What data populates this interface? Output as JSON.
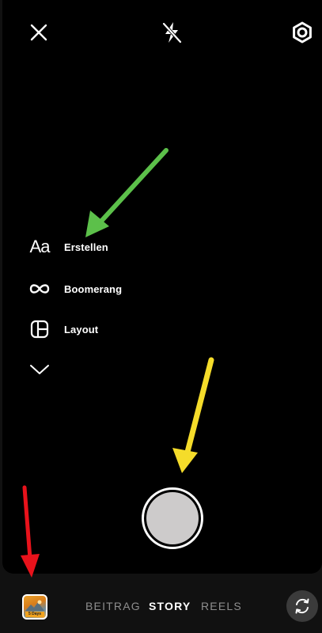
{
  "top_bar": {
    "close_icon": "close-icon",
    "flash_icon": "flash-off-icon",
    "settings_icon": "settings-gear-icon"
  },
  "modes": [
    {
      "icon": "text-aa-icon",
      "icon_text": "Aa",
      "label": "Erstellen"
    },
    {
      "icon": "infinity-icon",
      "label": "Boomerang"
    },
    {
      "icon": "layout-grid-icon",
      "label": "Layout"
    },
    {
      "icon": "chevron-down-icon",
      "label": ""
    }
  ],
  "bottom_bar": {
    "gallery_thumbnail": {
      "icon": "gallery-thumbnail",
      "caption": "5 Days"
    },
    "tabs": [
      {
        "label": "BEITRAG",
        "active": false
      },
      {
        "label": "STORY",
        "active": true
      },
      {
        "label": "REELS",
        "active": false
      }
    ],
    "flip_camera_icon": "flip-camera-icon"
  },
  "annotations": {
    "green_arrow_color": "#5cc04a",
    "yellow_arrow_color": "#f5dc2a",
    "red_arrow_color": "#e8121b"
  }
}
